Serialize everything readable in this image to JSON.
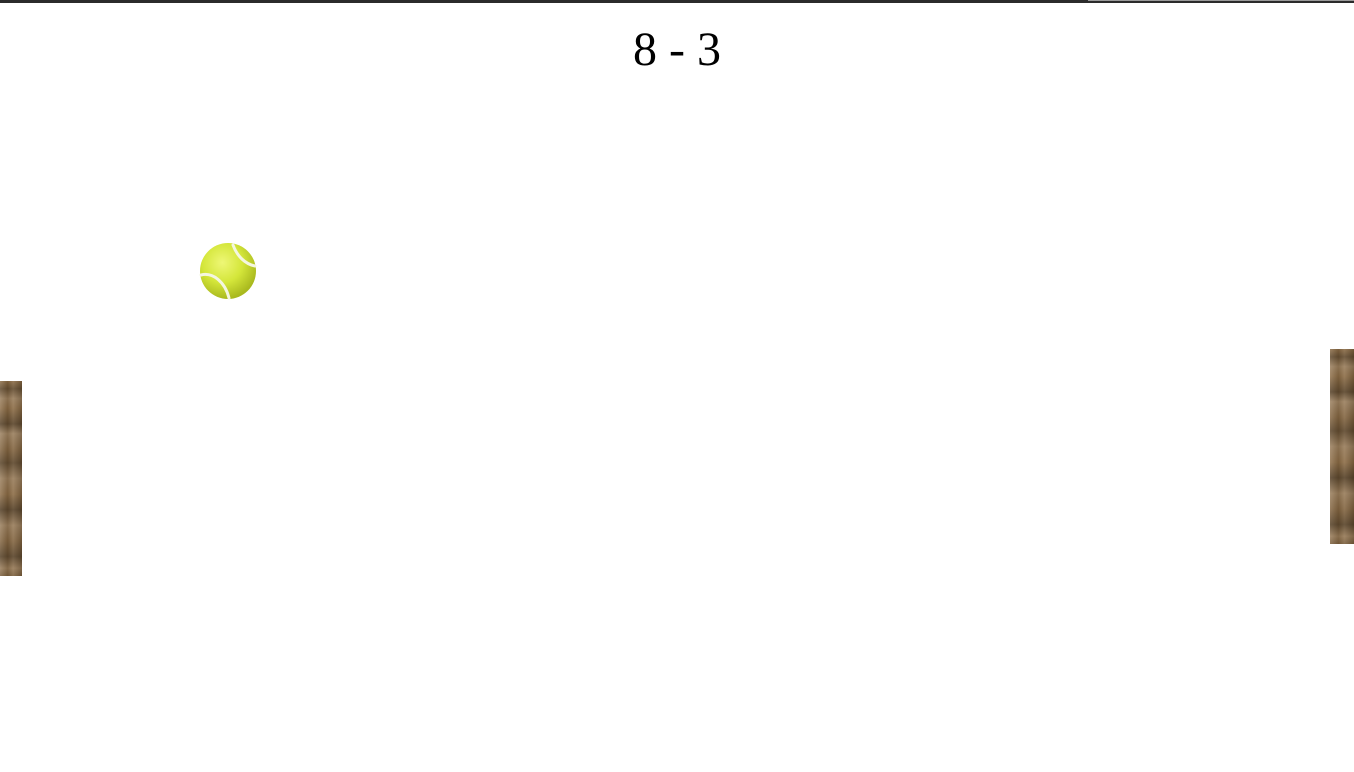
{
  "score": {
    "text": "8 - 3",
    "left_player": 8,
    "right_player": 3
  },
  "ball": {
    "icon": "tennis-ball-icon",
    "color": "#d4e63a"
  },
  "paddles": {
    "left": {
      "texture": "wood",
      "color": "#8a6a43"
    },
    "right": {
      "texture": "wood",
      "color": "#8a6a43"
    }
  }
}
